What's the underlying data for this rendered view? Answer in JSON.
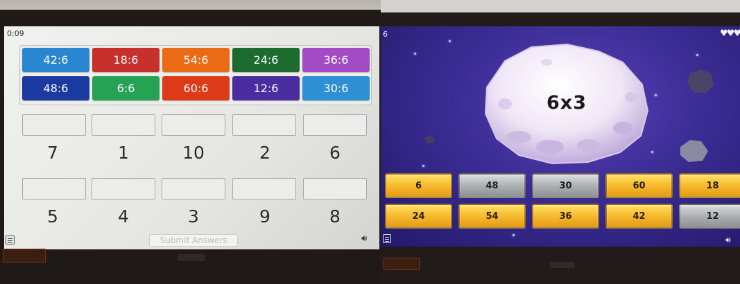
{
  "left_game": {
    "timer": "0:09",
    "cards_row1": [
      {
        "label": "42:6",
        "color": "#2b86d1"
      },
      {
        "label": "18:6",
        "color": "#c7302b"
      },
      {
        "label": "54:6",
        "color": "#ea6a16"
      },
      {
        "label": "24:6",
        "color": "#1d6b2e"
      },
      {
        "label": "36:6",
        "color": "#a24bc4"
      }
    ],
    "cards_row2": [
      {
        "label": "48:6",
        "color": "#1a3aa0"
      },
      {
        "label": "6:6",
        "color": "#26a255"
      },
      {
        "label": "60:6",
        "color": "#dc3a18"
      },
      {
        "label": "12:6",
        "color": "#4a2ea0"
      },
      {
        "label": "30:6",
        "color": "#2d8fd4"
      }
    ],
    "answer_numbers_row1": [
      "7",
      "1",
      "10",
      "2",
      "6"
    ],
    "answer_numbers_row2": [
      "5",
      "4",
      "3",
      "9",
      "8"
    ],
    "submit_label": "Submit Answers",
    "icons": {
      "menu": "menu-icon",
      "sound": "speaker-icon"
    }
  },
  "right_game": {
    "score": "6",
    "lives_glyph": "♥♥♥",
    "question": "6x3",
    "answers_row1": [
      {
        "label": "6",
        "style": "gold"
      },
      {
        "label": "48",
        "style": "silver"
      },
      {
        "label": "30",
        "style": "silver"
      },
      {
        "label": "60",
        "style": "gold"
      },
      {
        "label": "18",
        "style": "gold"
      }
    ],
    "answers_row2": [
      {
        "label": "24",
        "style": "gold"
      },
      {
        "label": "54",
        "style": "gold"
      },
      {
        "label": "36",
        "style": "gold"
      },
      {
        "label": "42",
        "style": "gold"
      },
      {
        "label": "12",
        "style": "silver"
      }
    ],
    "sound_glyph": "🔊︎",
    "colors": {
      "space": "#3b2c94",
      "gold_tile": "#f6b62a",
      "silver_tile": "#a8adb0"
    }
  }
}
